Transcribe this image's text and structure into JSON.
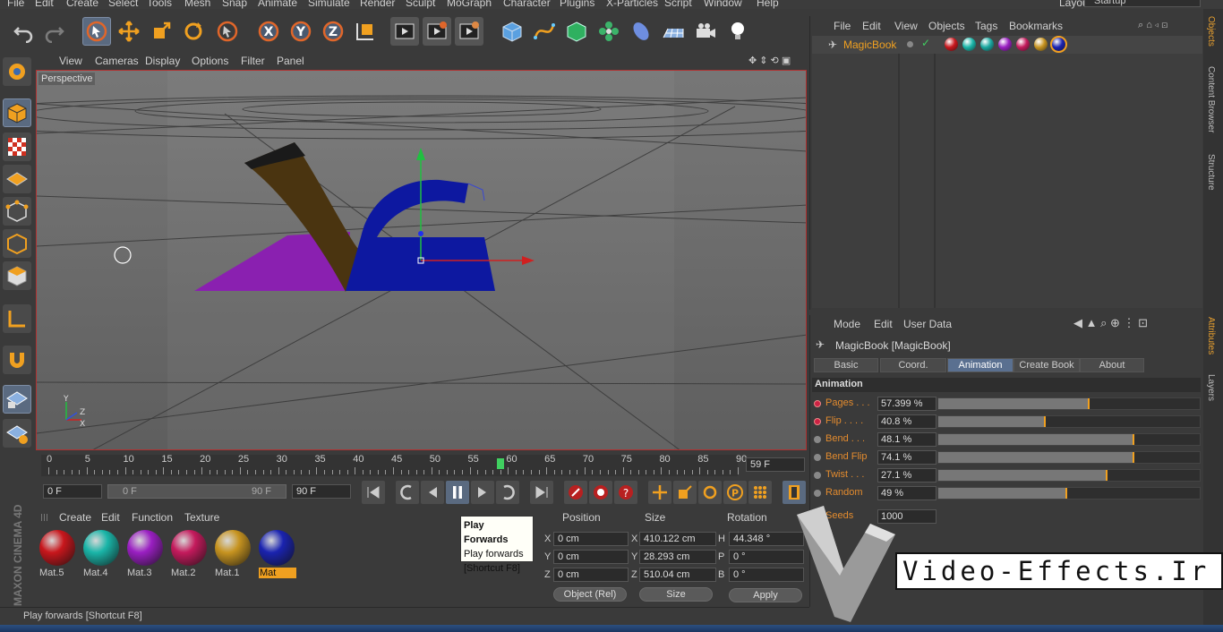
{
  "menubar": {
    "items": [
      "File",
      "Edit",
      "Create",
      "Select",
      "Tools",
      "Mesh",
      "Snap",
      "Animate",
      "Simulate",
      "Render",
      "Sculpt",
      "MoGraph",
      "Character",
      "Plugins",
      "X-Particles",
      "Script",
      "Window",
      "Help"
    ],
    "layout_label": "Layout:",
    "layout_value": "Startup"
  },
  "toolbar": {
    "icons": [
      "undo-icon",
      "redo-icon",
      "live-selection-icon",
      "move-icon",
      "scale-icon",
      "rotate-icon",
      "last-tool-icon",
      "x-axis-icon",
      "y-axis-icon",
      "z-axis-icon",
      "coordinate-system-icon",
      "render-view-icon",
      "render-picture-viewer-icon",
      "edit-render-settings-icon",
      "cube-icon",
      "spline-pen-icon",
      "subdivision-surface-icon",
      "cloner-icon",
      "deformer-icon",
      "floor-icon",
      "camera-icon",
      "light-icon"
    ]
  },
  "viewport": {
    "menu": [
      "View",
      "Cameras",
      "Display",
      "Options",
      "Filter",
      "Panel"
    ],
    "label": "Perspective",
    "axis_x": "X",
    "axis_y": "Y",
    "axis_z": "Z"
  },
  "timeline": {
    "ticks": [
      "0",
      "5",
      "10",
      "15",
      "20",
      "25",
      "30",
      "35",
      "40",
      "45",
      "50",
      "55",
      "60",
      "65",
      "70",
      "75",
      "80",
      "85",
      "90"
    ],
    "current_frame": "59 F",
    "playhead_frame": 59,
    "max_frame": 90
  },
  "transport": {
    "start_field": "0 F",
    "range_start": "0 F",
    "range_end": "90 F",
    "end_field": "90 F"
  },
  "materials": {
    "menu": [
      "Create",
      "Edit",
      "Function",
      "Texture"
    ],
    "items": [
      {
        "label": "Mat.5",
        "color": "#c8161c"
      },
      {
        "label": "Mat.4",
        "color": "#1ab5a8"
      },
      {
        "label": "Mat.3",
        "color": "#9a1fc2"
      },
      {
        "label": "Mat.2",
        "color": "#c41a5c"
      },
      {
        "label": "Mat.1",
        "color": "#c79420"
      },
      {
        "label": "Mat",
        "color": "#1a23b0",
        "selected": true
      }
    ]
  },
  "tooltip": {
    "title": "Play Forwards",
    "line1": "Play forwards",
    "line2": "[Shortcut F8]"
  },
  "coordinates": {
    "headers": [
      "Position",
      "Size",
      "Rotation"
    ],
    "rows": [
      {
        "axis": "X",
        "pos": "0 cm",
        "size_axis": "X",
        "size": "410.122 cm",
        "rot_axis": "H",
        "rot": "44.348 °"
      },
      {
        "axis": "Y",
        "pos": "0 cm",
        "size_axis": "Y",
        "size": "28.293 cm",
        "rot_axis": "P",
        "rot": "0 °"
      },
      {
        "axis": "Z",
        "pos": "0 cm",
        "size_axis": "Z",
        "size": "510.04 cm",
        "rot_axis": "B",
        "rot": "0 °"
      }
    ],
    "mode": "Object (Rel)",
    "size_mode": "Size",
    "apply": "Apply"
  },
  "status": "Play forwards [Shortcut F8]",
  "objects": {
    "menu": [
      "File",
      "Edit",
      "View",
      "Objects",
      "Tags",
      "Bookmarks"
    ],
    "name": "MagicBook",
    "tags": [
      "#c8161c",
      "#1ab5a8",
      "#1aa8a0",
      "#9a1fc2",
      "#c41a5c",
      "#c79420",
      "#1a23b0"
    ]
  },
  "attributes": {
    "menu": [
      "Mode",
      "Edit",
      "User Data"
    ],
    "title": "MagicBook [MagicBook]",
    "tabs": [
      "Basic",
      "Coord.",
      "Animation",
      "Create Book",
      "About"
    ],
    "active_tab": "Animation",
    "section": "Animation",
    "params": [
      {
        "label": "Pages . . .",
        "value": "57.399 %",
        "fraction": 0.574,
        "keyed": true
      },
      {
        "label": "Flip  . . . .",
        "value": "40.8 %",
        "fraction": 0.408,
        "keyed": true
      },
      {
        "label": "Bend  . . .",
        "value": "48.1 %",
        "fraction": 0.747,
        "keyed": false
      },
      {
        "label": "Bend Flip",
        "value": "74.1 %",
        "fraction": 0.747,
        "keyed": false
      },
      {
        "label": "Twist  . . .",
        "value": "27.1 %",
        "fraction": 0.643,
        "keyed": false
      },
      {
        "label": "Random",
        "value": "49 %",
        "fraction": 0.49,
        "keyed": false
      }
    ],
    "seeds_label": "Seeds",
    "seeds_value": "1000"
  },
  "side_tabs": [
    "Objects",
    "Content Browser",
    "Structure",
    "Attributes",
    "Layers"
  ],
  "brand": "MAXON CINEMA 4D",
  "watermark": "Video-Effects.Ir"
}
